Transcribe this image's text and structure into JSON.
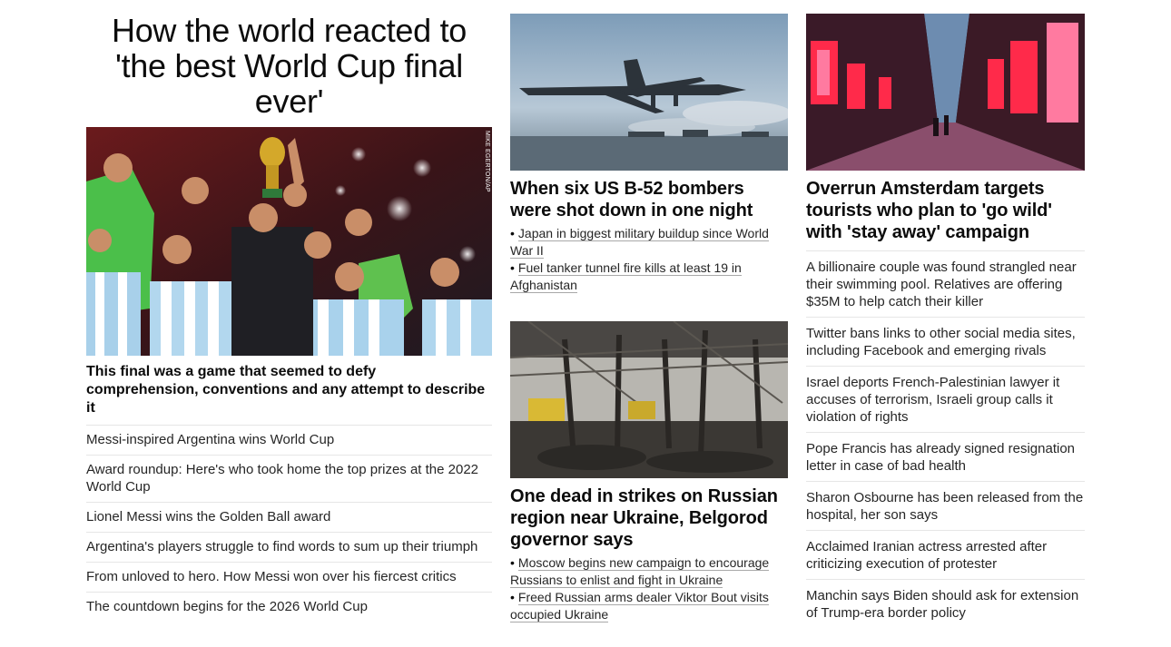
{
  "left": {
    "title": "How the world reacted to 'the best World Cup final ever'",
    "image": {
      "alt": "Argentina players celebrating with World Cup trophy",
      "credit": "MIKE EGERTON/AP",
      "icon": "photo"
    },
    "subhead": "This final was a game that seemed to defy comprehension, conventions and any attempt to describe it",
    "links": [
      "Messi-inspired Argentina wins World Cup",
      "Award roundup: Here's who took home the top prizes at the 2022 World Cup",
      "Lionel Messi wins the Golden Ball award",
      "Argentina's players struggle to find words to sum up their triumph",
      "From unloved to hero. How Messi won over his fiercest critics",
      "The countdown begins for the 2026 World Cup"
    ]
  },
  "middle": {
    "story1": {
      "image_alt": "B-52 bomber taking off",
      "headline": "When six US B-52 bombers were shot down in one night",
      "bullets": [
        "Japan in biggest military buildup since World War II",
        "Fuel tanker tunnel fire kills at least 19 in Afghanistan"
      ]
    },
    "story2": {
      "image_alt": "Destroyed building interior after strike",
      "headline": "One dead in strikes on Russian region near Ukraine, Belgorod governor says",
      "bullets": [
        "Moscow begins new campaign to encourage Russians to enlist and fight in Ukraine",
        "Freed Russian arms dealer Viktor Bout visits occupied Ukraine"
      ]
    }
  },
  "right": {
    "image_alt": "Amsterdam red light district street",
    "headline": "Overrun Amsterdam targets tourists who plan to 'go wild' with 'stay away' campaign",
    "links": [
      "A billionaire couple was found strangled near their swimming pool. Relatives are offering $35M to help catch their killer",
      "Twitter bans links to other social media sites, including Facebook and emerging rivals",
      "Israel deports French-Palestinian lawyer it accuses of terrorism, Israeli group calls it violation of rights",
      "Pope Francis has already signed resignation letter in case of bad health",
      "Sharon Osbourne has been released from the hospital, her son says",
      "Acclaimed Iranian actress arrested after criticizing execution of protester",
      "Manchin says Biden should ask for extension of Trump-era border policy"
    ]
  },
  "bullet_char": "•"
}
